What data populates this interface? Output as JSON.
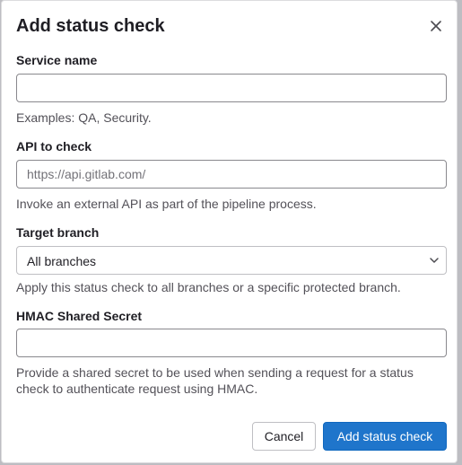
{
  "modal": {
    "title": "Add status check",
    "close_icon": "close-icon"
  },
  "fields": {
    "service_name": {
      "label": "Service name",
      "value": "",
      "placeholder": "",
      "help": "Examples: QA, Security."
    },
    "api_to_check": {
      "label": "API to check",
      "value": "",
      "placeholder": "https://api.gitlab.com/",
      "help": "Invoke an external API as part of the pipeline process."
    },
    "target_branch": {
      "label": "Target branch",
      "selected": "All branches",
      "icon": "chevron-down-icon",
      "help": "Apply this status check to all branches or a specific protected branch."
    },
    "hmac_secret": {
      "label": "HMAC Shared Secret",
      "value": "",
      "placeholder": "",
      "help": "Provide a shared secret to be used when sending a request for a status check to authenticate request using HMAC."
    }
  },
  "footer": {
    "cancel_label": "Cancel",
    "submit_label": "Add status check"
  },
  "colors": {
    "primary": "#1f75cb",
    "text": "#1f1e24",
    "help_text": "#535158"
  }
}
